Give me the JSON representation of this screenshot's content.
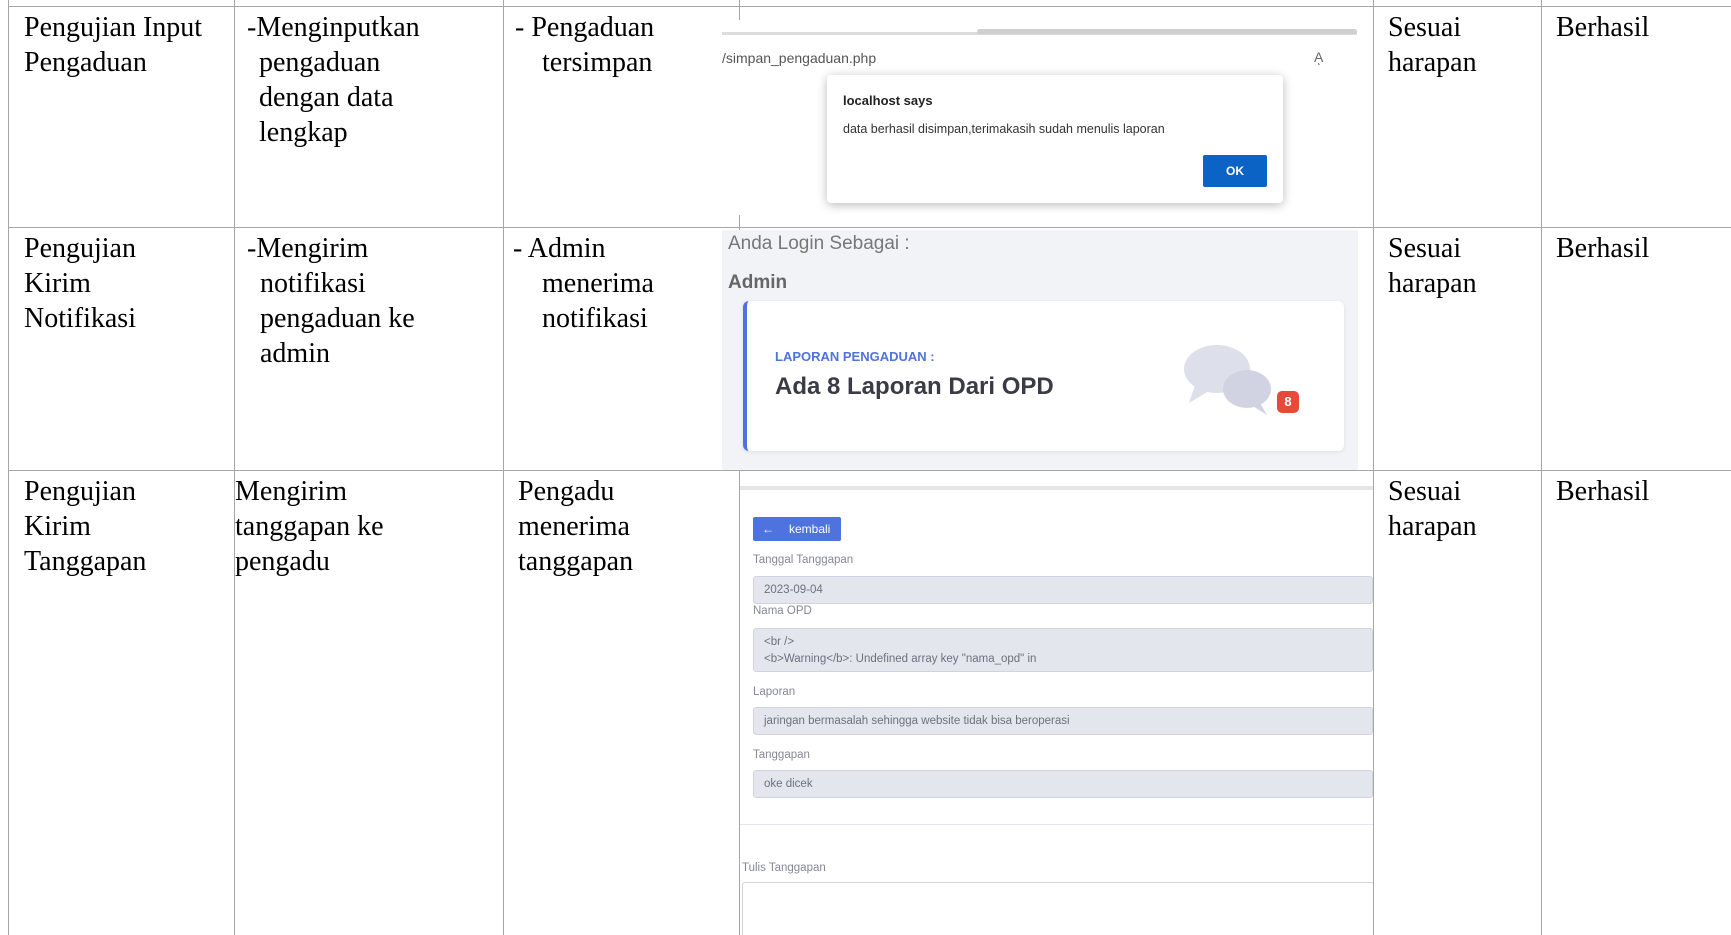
{
  "rows": [
    {
      "test": [
        "Pengujian Input",
        "Pengaduan"
      ],
      "step": [
        "-Menginputkan",
        "pengaduan",
        "dengan data",
        "lengkap"
      ],
      "expected": [
        "- Pengaduan",
        "tersimpan"
      ],
      "result": [
        "Sesuai",
        "harapan"
      ],
      "status": "Berhasil"
    },
    {
      "test": [
        "Pengujian",
        "Kirim",
        "Notifikasi"
      ],
      "step": [
        "-Mengirim",
        "notifikasi",
        "pengaduan ke",
        "admin"
      ],
      "expected": [
        "- Admin",
        "menerima",
        "notifikasi"
      ],
      "result": [
        "Sesuai",
        "harapan"
      ],
      "status": "Berhasil"
    },
    {
      "test": [
        "Pengujian",
        "Kirim",
        "Tanggapan"
      ],
      "step": [
        "Mengirim",
        "tanggapan ke",
        "pengadu"
      ],
      "expected": [
        "Pengadu",
        "menerima",
        "tanggapan"
      ],
      "result": [
        "Sesuai",
        "harapan"
      ],
      "status": "Berhasil"
    }
  ],
  "screenshot1": {
    "url": "/simpan_pengaduan.php",
    "read_aloud_icon": "Aͅ",
    "dialog_title": "localhost says",
    "dialog_message": "data berhasil disimpan,terimakasih sudah menulis laporan",
    "ok_label": "OK"
  },
  "screenshot2": {
    "login_as": "Anda Login Sebagai :",
    "role": "Admin",
    "card_title": "LAPORAN PENGADUAN :",
    "card_value": "Ada 8 Laporan Dari OPD",
    "badge_count": "8",
    "accent": "#4e73df",
    "badge_color": "#e74a3b",
    "icon": "comments-icon"
  },
  "screenshot3": {
    "back_label": "kembali",
    "back_icon": "arrow-left-icon",
    "fields": [
      {
        "label": "Tanggal Tanggapan",
        "value": [
          "2023-09-04"
        ]
      },
      {
        "label": "Nama OPD",
        "value": [
          "<br />",
          "<b>Warning</b>:  Undefined array key \"nama_opd\" in"
        ]
      },
      {
        "label": "Laporan",
        "value": [
          "jaringan bermasalah sehingga website tidak bisa beroperasi"
        ]
      },
      {
        "label": "Tanggapan",
        "value": [
          "oke dicek"
        ]
      }
    ],
    "write_label": "Tulis Tanggapan"
  }
}
